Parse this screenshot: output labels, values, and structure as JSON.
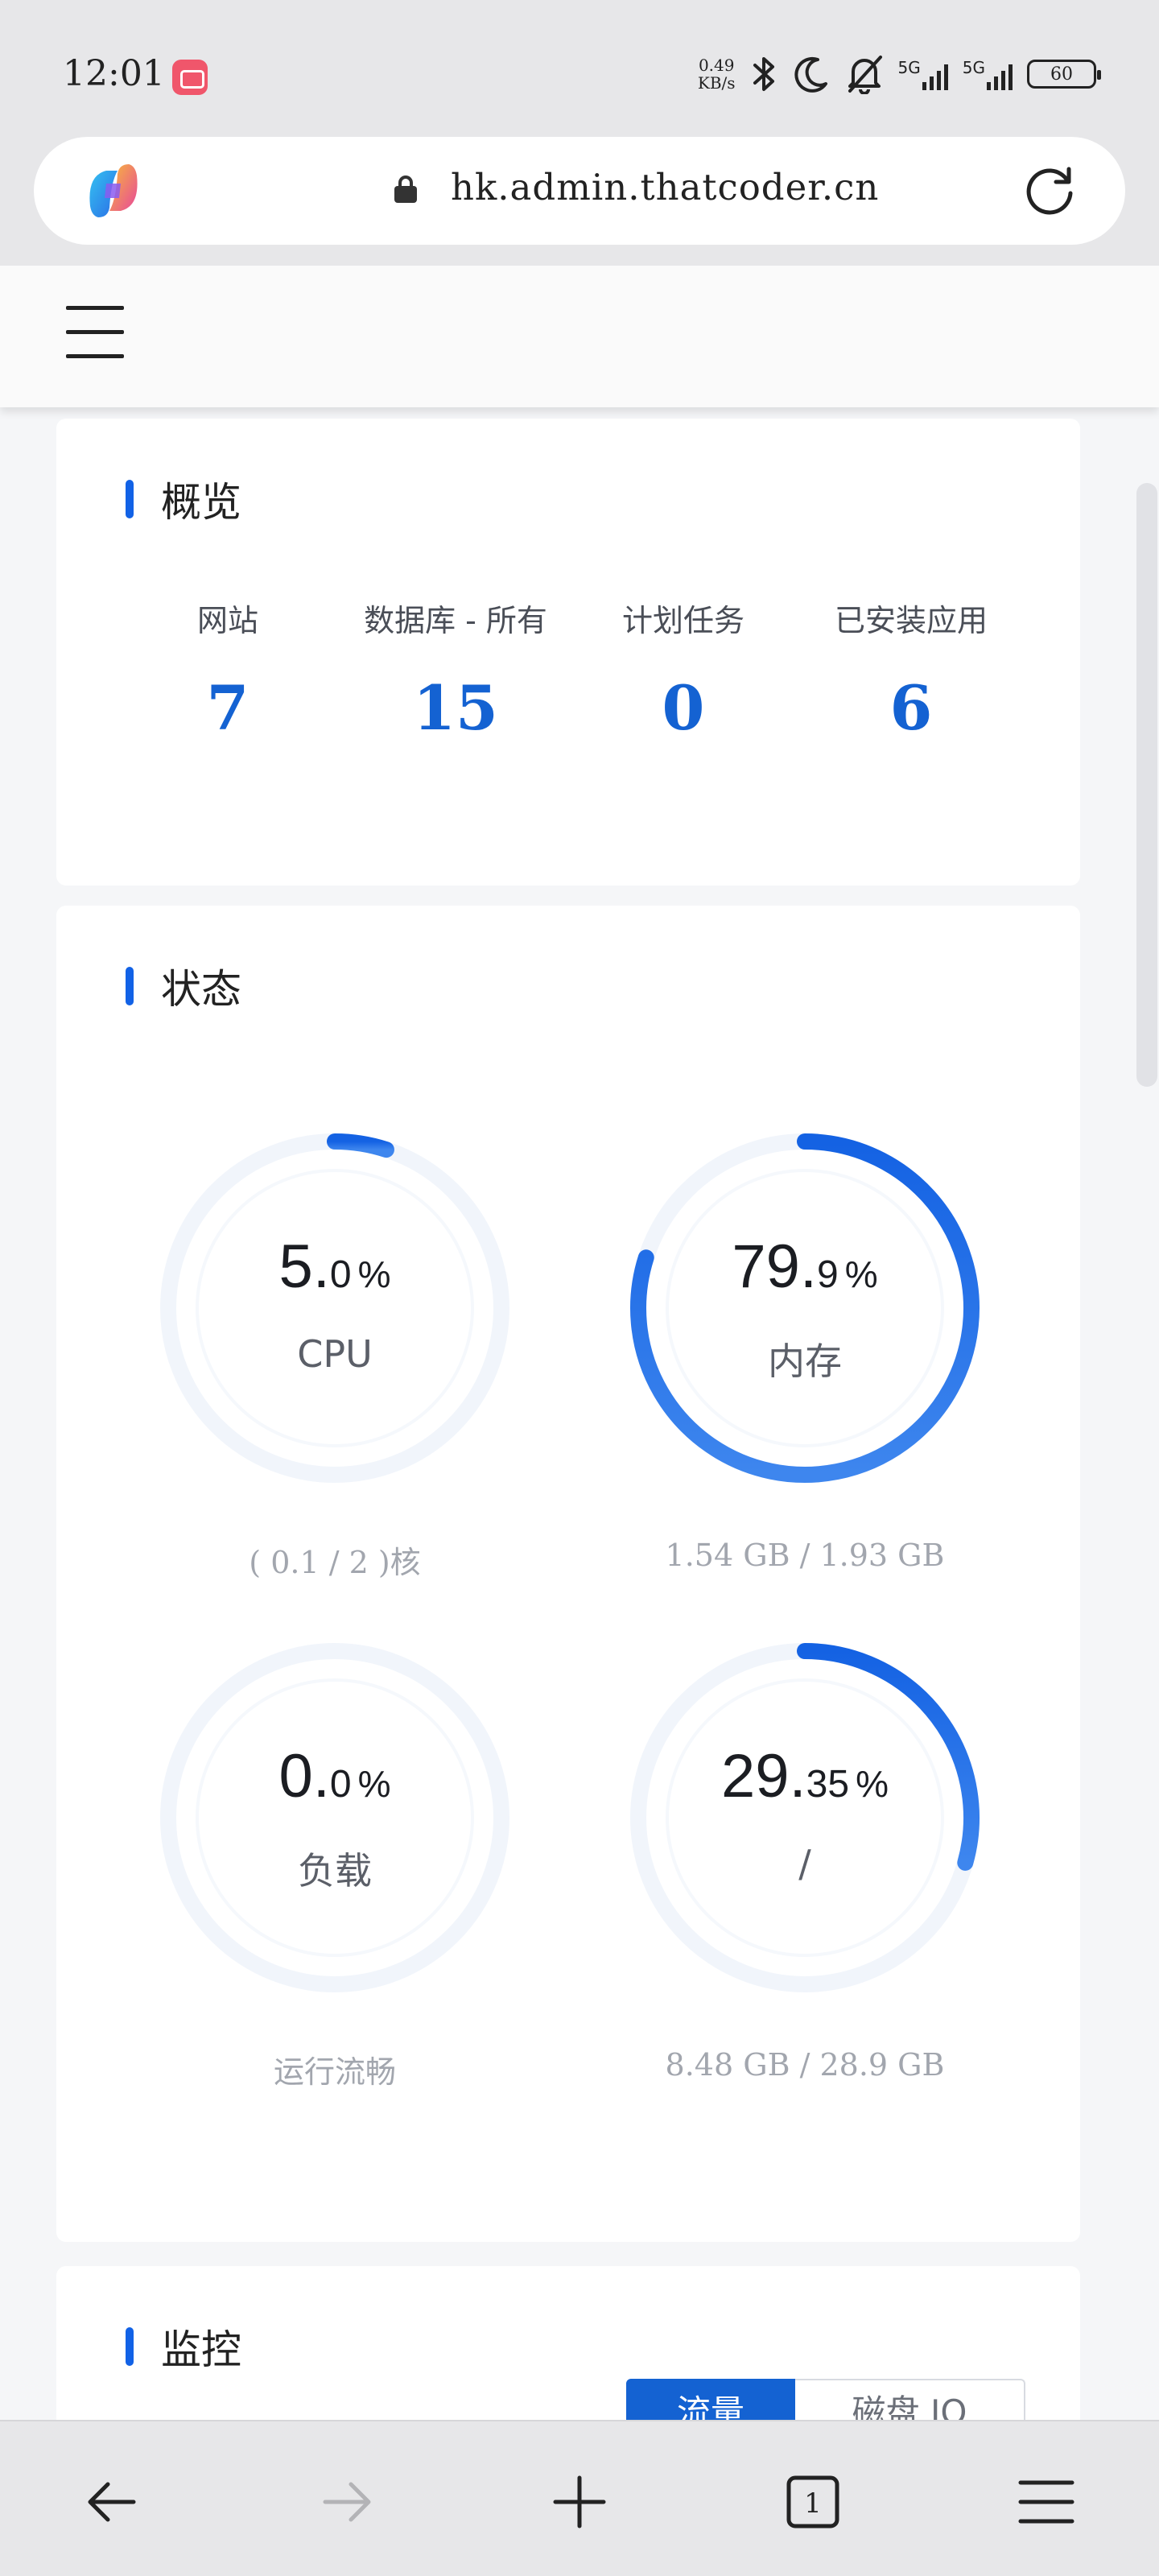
{
  "status_bar": {
    "time": "12:01",
    "net_speed_value": "0.49",
    "net_speed_unit": "KB/s",
    "signal_1_label": "5G",
    "signal_2_label": "5G",
    "battery": "60",
    "icons": [
      "bluetooth-icon",
      "moon-icon",
      "bell-off-icon",
      "signal-icon",
      "battery-icon"
    ]
  },
  "browser": {
    "url": "hk.admin.thatcoder.cn",
    "icons": [
      "copilot-icon",
      "lock-icon",
      "reload-icon"
    ]
  },
  "overview": {
    "title": "概览",
    "items": [
      {
        "label": "网站",
        "value": "7"
      },
      {
        "label": "数据库 - 所有",
        "value": "15"
      },
      {
        "label": "计划任务",
        "value": "0"
      },
      {
        "label": "已安装应用",
        "value": "6"
      }
    ]
  },
  "status": {
    "title": "状态",
    "gauges": [
      {
        "int": "5.",
        "dec": "0",
        "unit": "%",
        "name": "CPU",
        "sub": "( 0.1 / 2 )核",
        "percent": 5.0
      },
      {
        "int": "79.",
        "dec": "9",
        "unit": "%",
        "name": "内存",
        "sub": "1.54 GB / 1.93 GB",
        "percent": 79.9
      },
      {
        "int": "0.",
        "dec": "0",
        "unit": "%",
        "name": "负载",
        "sub": "运行流畅",
        "percent": 0.0
      },
      {
        "int": "29.",
        "dec": "35",
        "unit": "%",
        "name": "/",
        "sub": "8.48 GB / 28.9 GB",
        "percent": 29.35
      }
    ]
  },
  "monitor": {
    "title": "监控",
    "tabs": [
      "流量",
      "磁盘 IO"
    ]
  },
  "colors": {
    "accent": "#1462d2",
    "gauge_track": "#f1f5fb",
    "gauge_fill": "#1a66e3"
  }
}
